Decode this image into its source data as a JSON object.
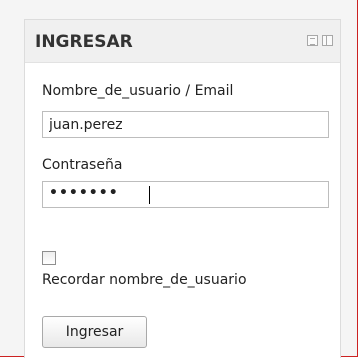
{
  "login_block": {
    "title": "INGRESAR",
    "username_label": "Nombre_de_usuario / Email",
    "username_value": "juan.perez",
    "password_label": "Contraseña",
    "password_masked": "•••••••",
    "remember_label": "Recordar nombre_de_usuario",
    "remember_checked": false,
    "submit_label": "Ingresar"
  },
  "icons": [
    "hide-block-icon",
    "dock-block-icon"
  ],
  "colors": {
    "frame_border": "#cc2222",
    "header_bg": "#f0f0f0",
    "input_border": "#bdbdbd"
  }
}
